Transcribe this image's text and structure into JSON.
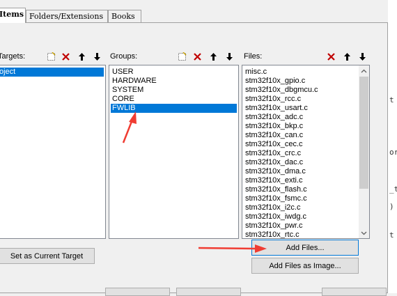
{
  "tabs": [
    {
      "label": "Items"
    },
    {
      "label": "Folders/Extensions"
    },
    {
      "label": "Books"
    }
  ],
  "targets": {
    "header": "Targets:",
    "items": [
      "oject"
    ]
  },
  "groups": {
    "header": "Groups:",
    "items": [
      "USER",
      "HARDWARE",
      "SYSTEM",
      "CORE",
      "FWLIB"
    ],
    "selected": "FWLIB"
  },
  "files": {
    "header": "Files:",
    "items": [
      "misc.c",
      "stm32f10x_gpio.c",
      "stm32f10x_dbgmcu.c",
      "stm32f10x_rcc.c",
      "stm32f10x_usart.c",
      "stm32f10x_adc.c",
      "stm32f10x_bkp.c",
      "stm32f10x_can.c",
      "stm32f10x_cec.c",
      "stm32f10x_crc.c",
      "stm32f10x_dac.c",
      "stm32f10x_dma.c",
      "stm32f10x_exti.c",
      "stm32f10x_flash.c",
      "stm32f10x_fsmc.c",
      "stm32f10x_i2c.c",
      "stm32f10x_iwdg.c",
      "stm32f10x_pwr.c",
      "stm32f10x_rtc.c"
    ]
  },
  "buttons": {
    "set_current_target": "Set as Current Target",
    "add_files": "Add Files...",
    "add_files_as_image": "Add Files as Image..."
  },
  "icons": {
    "new": "new-item-icon",
    "delete": "delete-icon",
    "up": "move-up-icon",
    "down": "move-down-icon"
  },
  "background_code_fragments": [
    "t",
    "or",
    "_t",
    ")",
    "t"
  ],
  "colors": {
    "selection": "#0078d7",
    "annotation_arrow": "#f03c32"
  }
}
